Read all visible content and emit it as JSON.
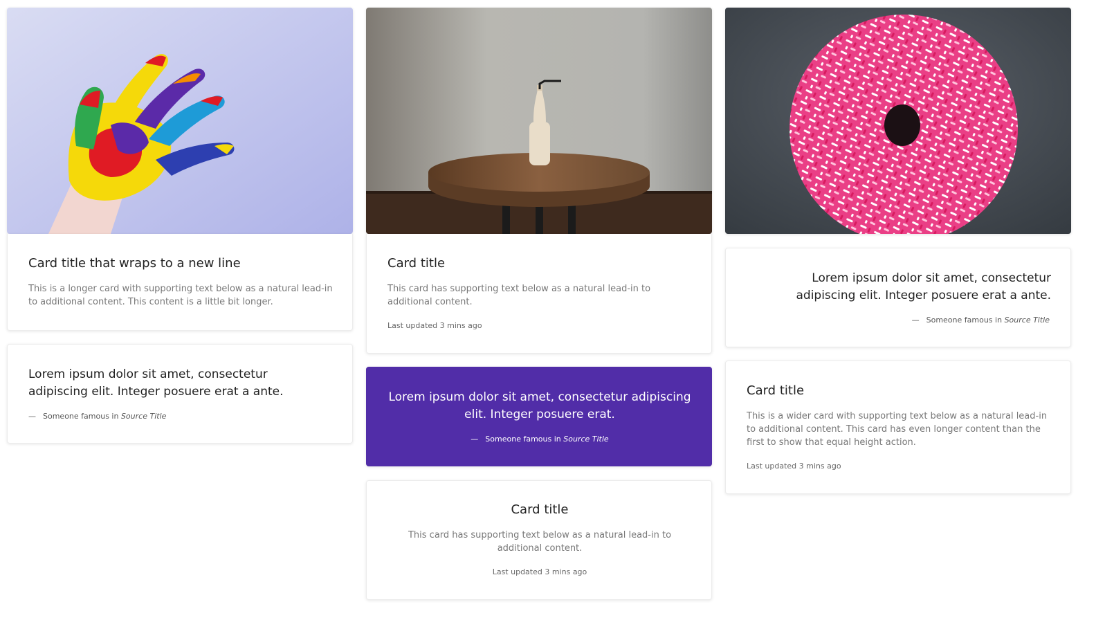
{
  "colors": {
    "accent_card_bg": "#512DA8",
    "title": "#222222",
    "muted_text": "#777777"
  },
  "cards": {
    "hand_image": {
      "icon": "painted-hand-image"
    },
    "card1": {
      "title": "Card title that wraps to a new line",
      "text": "This is a longer card with supporting text below as a natural lead-in to additional content. This content is a little bit longer."
    },
    "quote1": {
      "text": "Lorem ipsum dolor sit amet, consectetur adipiscing elit. Integer posuere erat a ante.",
      "dash": "—",
      "footer_prefix": "Someone famous in",
      "source": "Source Title"
    },
    "table_image": {
      "icon": "bottle-on-table-image"
    },
    "card2": {
      "title": "Card title",
      "text": "This card has supporting text below as a natural lead-in to additional content.",
      "updated": "Last updated 3 mins ago"
    },
    "quote_accent": {
      "text": "Lorem ipsum dolor sit amet, consectetur adipiscing elit. Integer posuere erat.",
      "dash": "—",
      "footer_prefix": "Someone famous in",
      "source": "Source Title"
    },
    "card3": {
      "title": "Card title",
      "text": "This card has supporting text below as a natural lead-in to additional content.",
      "updated": "Last updated 3 mins ago"
    },
    "donut_image": {
      "icon": "sprinkled-donut-image"
    },
    "quote2": {
      "text": "Lorem ipsum dolor sit amet, consectetur adipiscing elit. Integer posuere erat a ante.",
      "dash": "—",
      "footer_prefix": "Someone famous in",
      "source": "Source Title"
    },
    "card4": {
      "title": "Card title",
      "text": "This is a wider card with supporting text below as a natural lead-in to additional content. This card has even longer content than the first to show that equal height action.",
      "updated": "Last updated 3 mins ago"
    }
  }
}
